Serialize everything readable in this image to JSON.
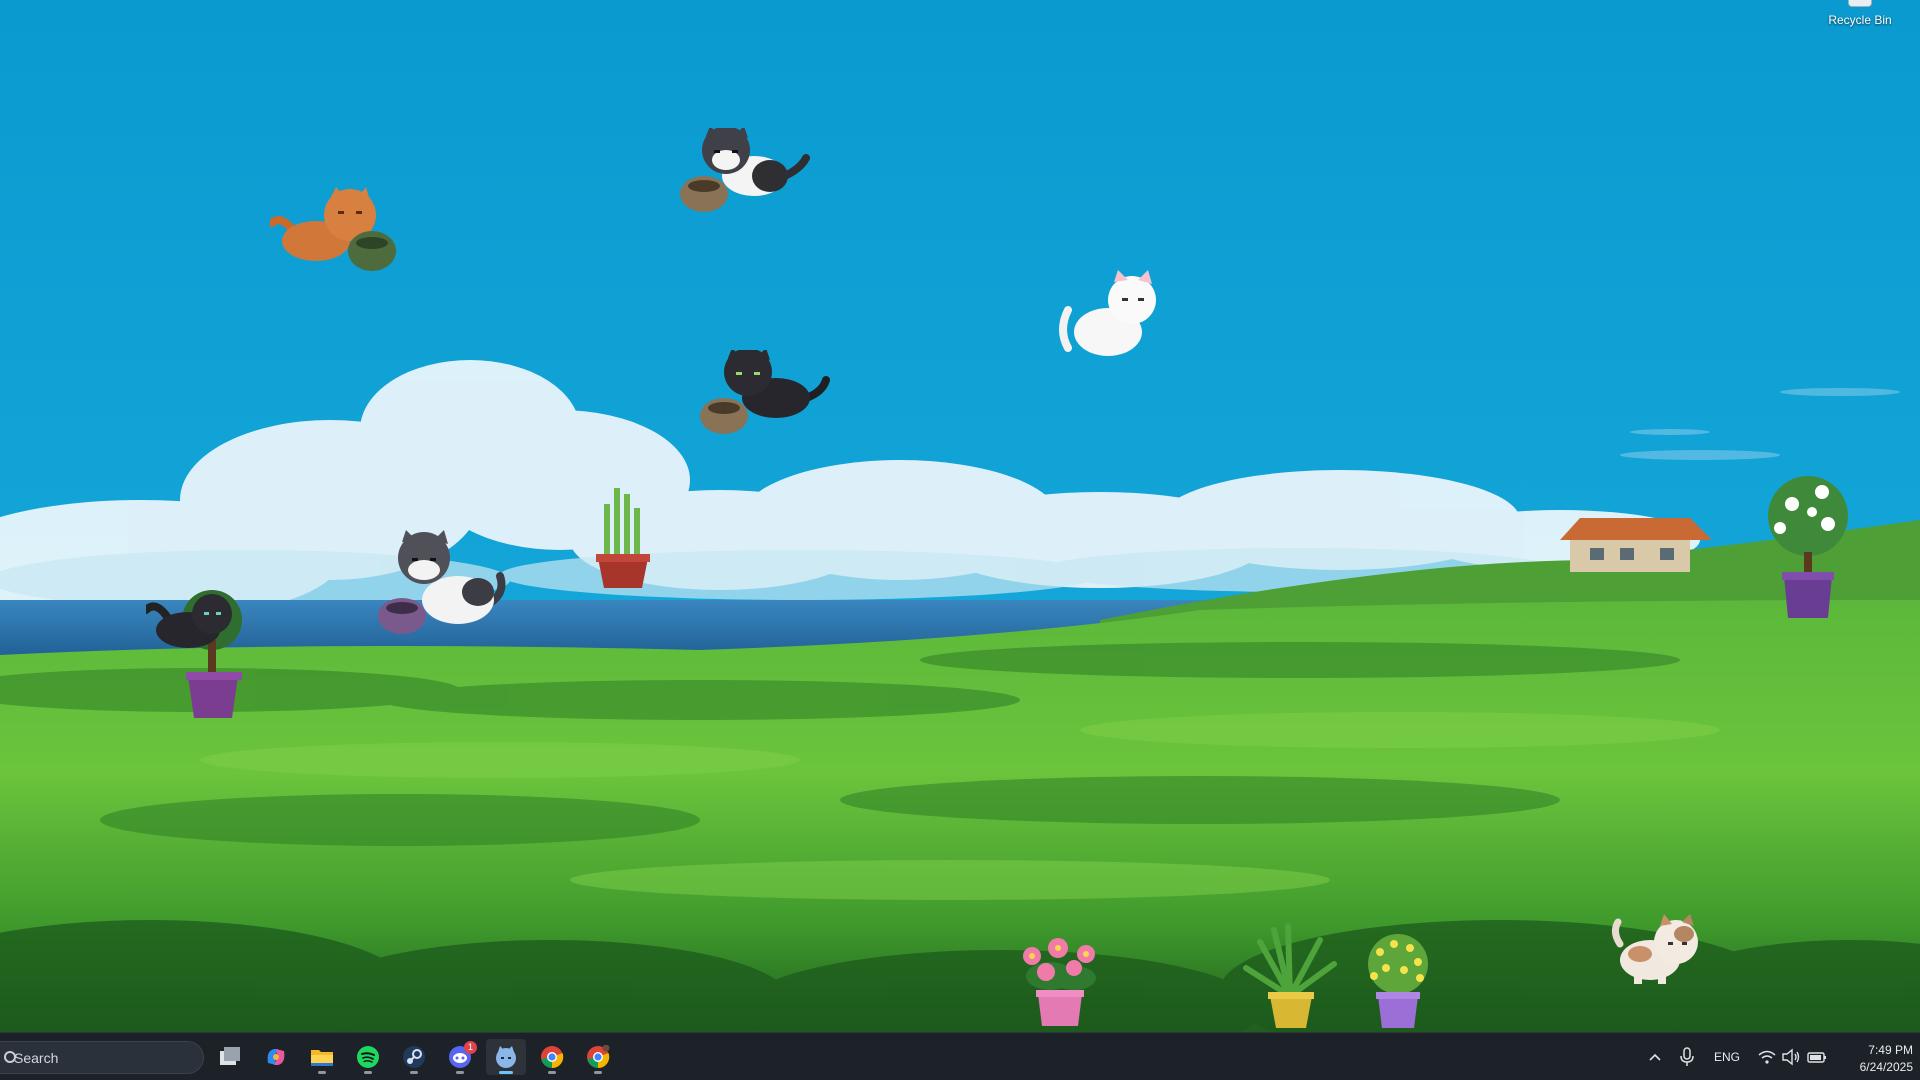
{
  "desktop": {
    "recycle_bin_label": "Recycle Bin",
    "colors": {
      "sky": "#0fa0d2",
      "grass": "#4ea832",
      "sea": "#2c73a8"
    }
  },
  "taskbar": {
    "search_placeholder": "Search",
    "apps": [
      {
        "name": "task-view",
        "icon": "task-view-icon"
      },
      {
        "name": "copilot",
        "icon": "copilot-icon"
      },
      {
        "name": "file-explorer",
        "icon": "folder-icon"
      },
      {
        "name": "spotify",
        "icon": "spotify-icon"
      },
      {
        "name": "steam",
        "icon": "steam-icon"
      },
      {
        "name": "discord",
        "icon": "discord-icon",
        "badge": "1"
      },
      {
        "name": "desktop-pet",
        "icon": "pet-app-icon",
        "active": true
      },
      {
        "name": "chrome",
        "icon": "chrome-icon"
      },
      {
        "name": "chrome-profile",
        "icon": "chrome-icon"
      }
    ],
    "tray": {
      "language": "ENG",
      "time": "7:49 PM",
      "date": "6/24/2025"
    }
  }
}
